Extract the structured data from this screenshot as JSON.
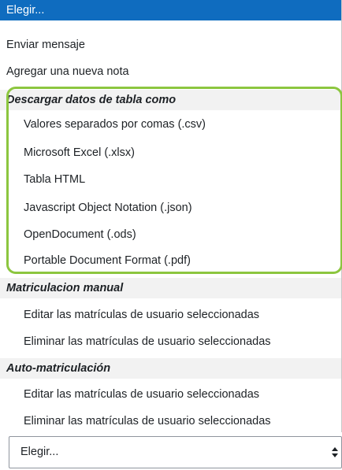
{
  "dropdown": {
    "selected_label": "Elegir...",
    "items": [
      {
        "label": "Enviar mensaje"
      },
      {
        "label": "Agregar una nueva nota"
      }
    ],
    "groups": [
      {
        "label": "Descargar datos de tabla como",
        "options": [
          "Valores separados por comas (.csv)",
          "Microsoft Excel (.xlsx)",
          "Tabla HTML",
          "Javascript Object Notation (.json)",
          "OpenDocument (.ods)",
          "Portable Document Format (.pdf)"
        ]
      },
      {
        "label": "Matriculacion manual",
        "options": [
          "Editar las matrículas de usuario seleccionadas",
          "Eliminar las matrículas de usuario seleccionadas"
        ]
      },
      {
        "label": "Auto-matriculación",
        "options": [
          "Editar las matrículas de usuario seleccionadas",
          "Eliminar las matrículas de usuario seleccionadas"
        ]
      }
    ]
  },
  "select": {
    "value": "Elegir...",
    "icon": "up-down-arrow-icon"
  },
  "colors": {
    "selected_bg": "#0f6cbf",
    "group_bg": "#f2f2f2",
    "highlight": "#8cc63f"
  }
}
